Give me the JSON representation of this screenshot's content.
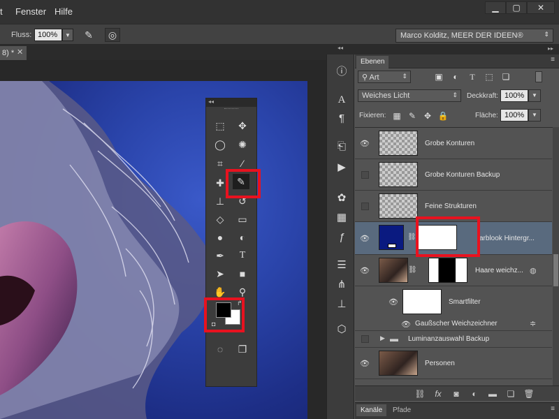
{
  "menu": {
    "items": [
      "t",
      "Fenster",
      "Hilfe"
    ]
  },
  "window": {
    "min": "▁",
    "max": "▢",
    "close": "✕"
  },
  "options": {
    "fluss_label": "Fluss:",
    "fluss_value": "100%",
    "preset": "Marco Kolditz, MEER DER IDEEN®"
  },
  "document": {
    "tab_label": "8) *",
    "close": "✕"
  },
  "layers_panel": {
    "tab": "Ebenen",
    "filter_value": "Art",
    "blend_mode": "Weiches Licht",
    "opacity_label": "Deckkraft:",
    "opacity_value": "100%",
    "lock_label": "Fixieren:",
    "fill_label": "Fläche:",
    "fill_value": "100%",
    "layers": [
      {
        "name": "Grobe Konturen",
        "visible": true,
        "selected": false
      },
      {
        "name": "Grobe Konturen Backup",
        "visible": false,
        "selected": false
      },
      {
        "name": "Feine Strukturen",
        "visible": false,
        "selected": false
      },
      {
        "name": "arblook Hintergr...",
        "visible": true,
        "selected": true
      },
      {
        "name": "Haare weichz...",
        "visible": true,
        "selected": false
      },
      {
        "name": "Smartfilter",
        "visible": true,
        "selected": false
      },
      {
        "name": "Gaußscher Weichzeichner",
        "visible": true,
        "selected": false
      },
      {
        "name": "Luminanzauswahl Backup",
        "visible": false,
        "selected": false
      },
      {
        "name": "Personen",
        "visible": true,
        "selected": false
      }
    ]
  },
  "bottom_tabs": [
    "Kanäle",
    "Pfade"
  ],
  "colors": {
    "highlight": "#e8121f",
    "selected_layer": "#596a7e",
    "foreground": "#000000",
    "background": "#ffffff",
    "fill_layer_color": "#0a1a80"
  }
}
